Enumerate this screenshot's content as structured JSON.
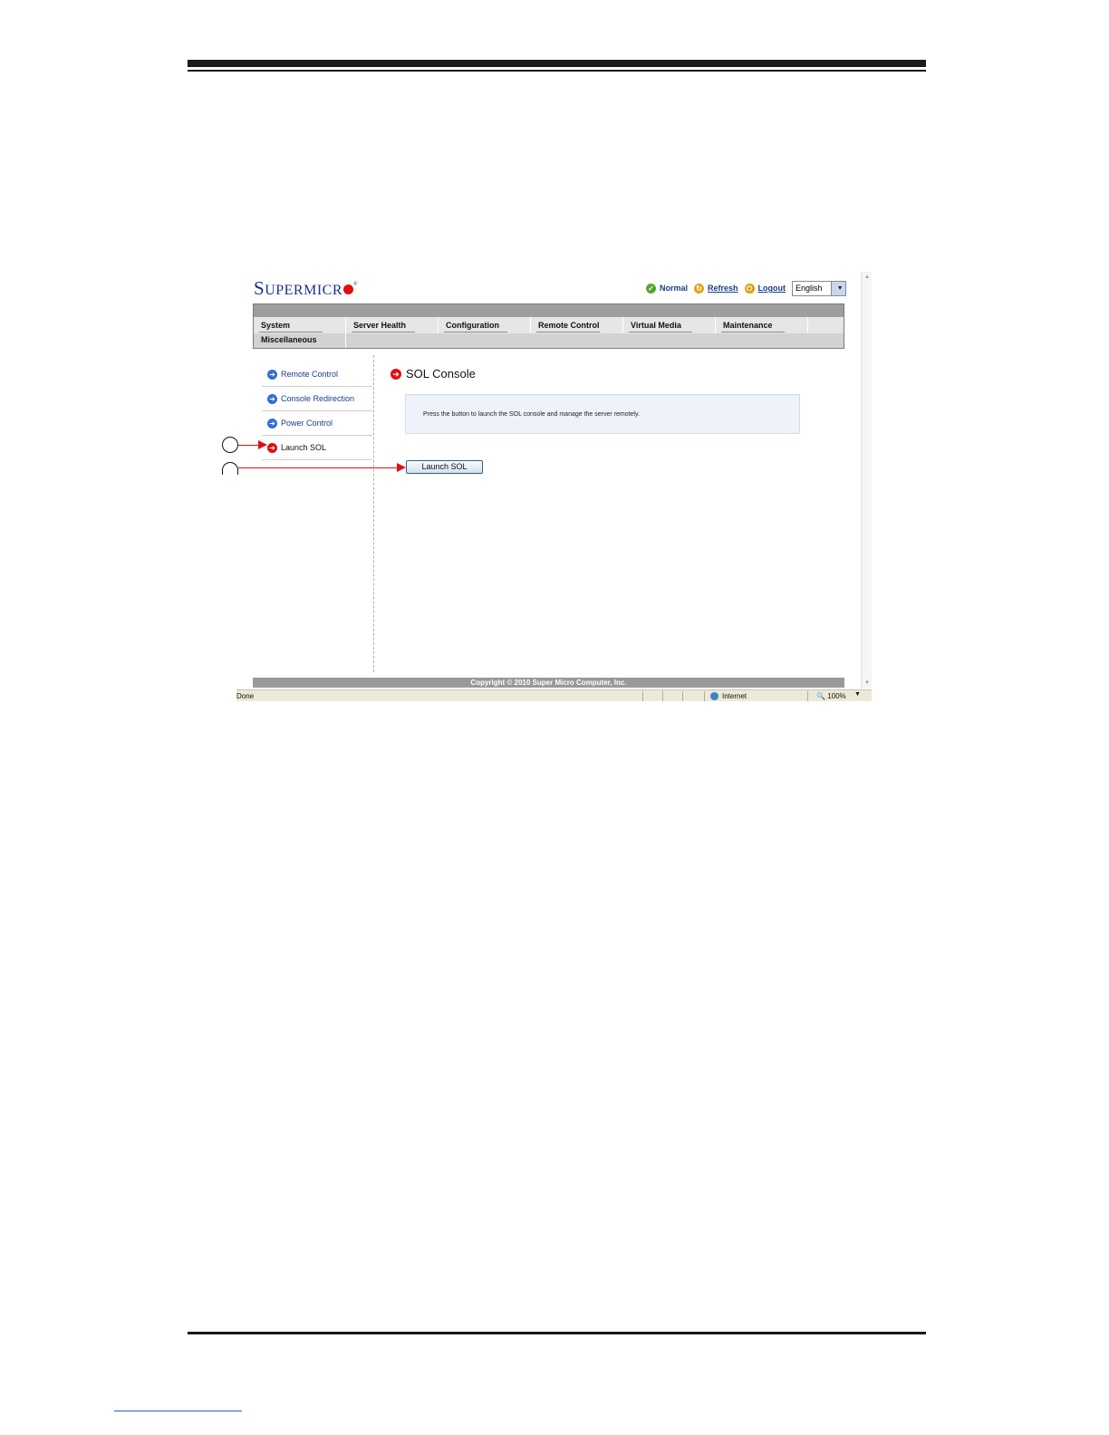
{
  "logo": {
    "first": "S",
    "rest": "UPERMICR",
    "reg": "®"
  },
  "topbar": {
    "status": "Normal",
    "refresh": "Refresh",
    "logout": "Logout",
    "language": "English"
  },
  "menu": {
    "row1": [
      "System",
      "Server Health",
      "Configuration",
      "Remote Control",
      "Virtual Media",
      "Maintenance"
    ],
    "row2": [
      "Miscellaneous"
    ]
  },
  "sidebar": {
    "items": [
      {
        "label": "Remote Control"
      },
      {
        "label": "Console Redirection"
      },
      {
        "label": "Power Control"
      },
      {
        "label": "Launch SOL"
      }
    ]
  },
  "main": {
    "title": "SOL Console",
    "info": "Press the button to launch the SOL console and manage the server remotely.",
    "button": "Launch SOL"
  },
  "footer": {
    "copyright": "Copyright © 2010 Super Micro Computer, Inc."
  },
  "statusbar": {
    "done": "Done",
    "zone": "Internet",
    "zoom": "100%"
  },
  "colors": {
    "accent": "#e01010",
    "link": "#1d3b8a",
    "brand": "#1f2f8f"
  }
}
